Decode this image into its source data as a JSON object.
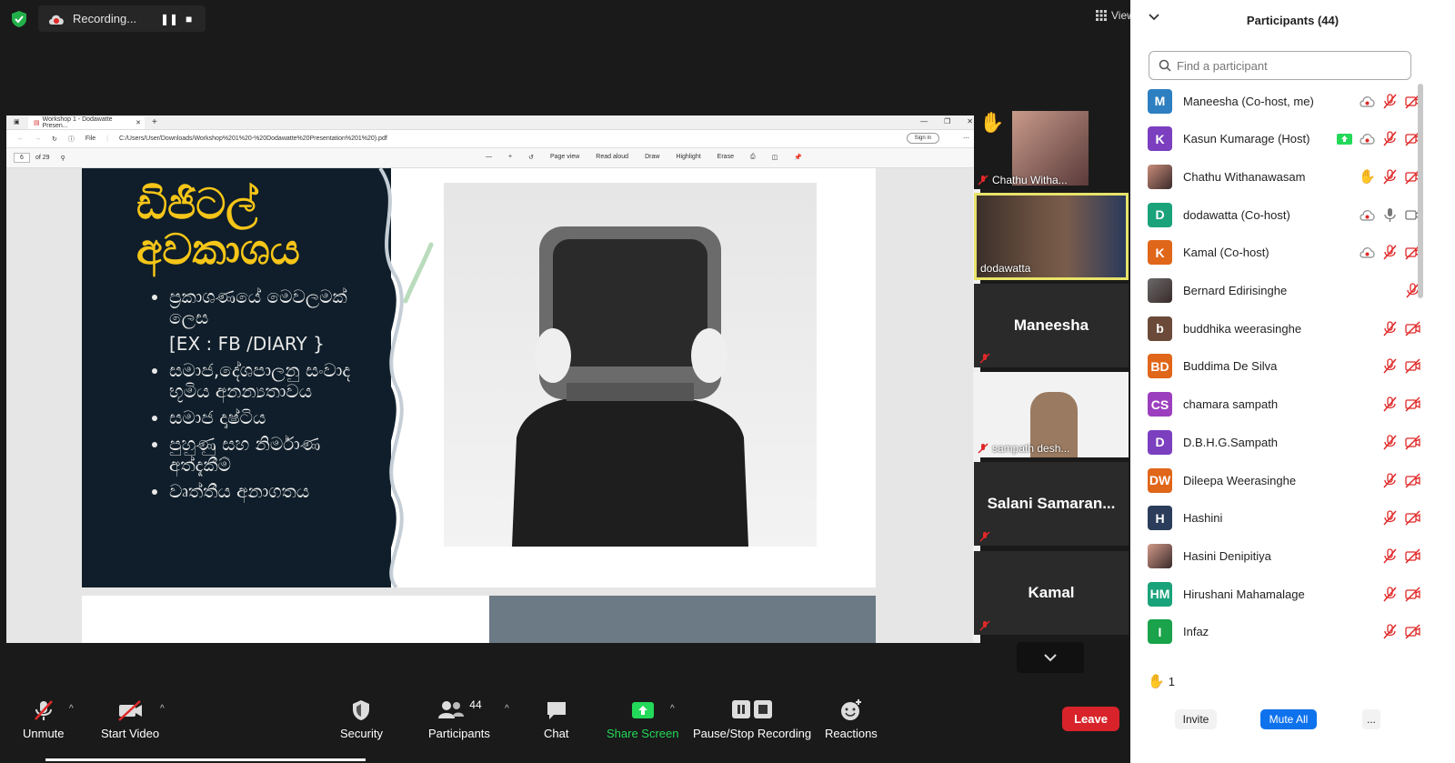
{
  "recording": {
    "label": "Recording..."
  },
  "view": {
    "label": "View"
  },
  "browser": {
    "tab_title": "Workshop 1 - Dodawatte Presen...",
    "file_label": "File",
    "url": "C:/Users/User/Downloads/Workshop%201%20-%20Dodawatte%20Presentation%201%20).pdf",
    "signin": "Sign in",
    "page_current": "6",
    "page_total": "of 29",
    "tools": {
      "page_view": "Page view",
      "read_aloud": "Read aloud",
      "draw": "Draw",
      "highlight": "Highlight",
      "erase": "Erase"
    }
  },
  "slide": {
    "title_line1": "ඩිජිටල්",
    "title_line2": "අවකාශය",
    "bullets": [
      "ප්‍රකාශණයේ මෙවලමක් ලෙස",
      "සමාජ,දේශපාලනු සංවාද භූමිය අනන්‍යතාවය",
      "සමාජ දෘෂ්ටිය",
      "පුහුණු සහ නිර්මාණ අත්දැකීම්",
      "වෘත්තීය අනාගතය"
    ],
    "sub_note": "[EX : FB /DIARY }"
  },
  "tiles": [
    {
      "name": "Chathu Witha...",
      "type": "video",
      "hand": true
    },
    {
      "name": "dodawatta",
      "type": "video",
      "active": true
    },
    {
      "name": "Maneesha",
      "type": "name"
    },
    {
      "name": "sampath desh...",
      "type": "video"
    },
    {
      "name": "Salani  Samaran...",
      "type": "name"
    },
    {
      "name": "Kamal",
      "type": "name"
    }
  ],
  "toolbar": {
    "unmute": "Unmute",
    "start_video": "Start Video",
    "security": "Security",
    "participants": "Participants",
    "participants_count": "44",
    "chat": "Chat",
    "share_screen": "Share Screen",
    "pause_stop": "Pause/Stop Recording",
    "reactions": "Reactions",
    "leave": "Leave"
  },
  "panel": {
    "title": "Participants (44)",
    "search_placeholder": "Find a participant",
    "raised_count": "1",
    "invite": "Invite",
    "mute_all": "Mute All",
    "more": "..."
  },
  "participants": [
    {
      "initials": "M",
      "name": "Maneesha (Co-host, me)",
      "color": "#2d7fc1",
      "icons": [
        "rec",
        "mic-off",
        "cam-off"
      ]
    },
    {
      "initials": "K",
      "name": "Kasun Kumarage (Host)",
      "color": "#7b3fbf",
      "icons": [
        "share",
        "rec",
        "mic-off",
        "cam-off"
      ]
    },
    {
      "initials": "",
      "name": "Chathu Withanawasam",
      "color": "#c98c7a",
      "photo": true,
      "icons": [
        "hand",
        "mic-off",
        "cam-off"
      ]
    },
    {
      "initials": "D",
      "name": "dodawatta (Co-host)",
      "color": "#1aa37a",
      "icons": [
        "rec",
        "mic-on",
        "cam-on"
      ]
    },
    {
      "initials": "K",
      "name": "Kamal (Co-host)",
      "color": "#e0661a",
      "icons": [
        "rec",
        "mic-off",
        "cam-off"
      ]
    },
    {
      "initials": "",
      "name": "Bernard Edirisinghe",
      "color": "#6a6a6a",
      "photo": true,
      "icons": [
        "mic-off"
      ]
    },
    {
      "initials": "b",
      "name": "buddhika weerasinghe",
      "color": "#6b4a3a",
      "icons": [
        "mic-off",
        "cam-off"
      ]
    },
    {
      "initials": "BD",
      "name": "Buddima De Silva",
      "color": "#e0661a",
      "icons": [
        "mic-off",
        "cam-off"
      ]
    },
    {
      "initials": "CS",
      "name": "chamara sampath",
      "color": "#9b3fbf",
      "icons": [
        "mic-off",
        "cam-off"
      ]
    },
    {
      "initials": "D",
      "name": "D.B.H.G.Sampath",
      "color": "#7b3fbf",
      "icons": [
        "mic-off",
        "cam-off"
      ]
    },
    {
      "initials": "DW",
      "name": "Dileepa Weerasinghe",
      "color": "#e0661a",
      "icons": [
        "mic-off",
        "cam-off"
      ]
    },
    {
      "initials": "H",
      "name": "Hashini",
      "color": "#2b3d5a",
      "icons": [
        "mic-off",
        "cam-off"
      ]
    },
    {
      "initials": "",
      "name": "Hasini Denipitiya",
      "color": "#d29a8a",
      "photo": true,
      "icons": [
        "mic-off",
        "cam-off"
      ]
    },
    {
      "initials": "HM",
      "name": "Hirushani Mahamalage",
      "color": "#1aa37a",
      "icons": [
        "mic-off",
        "cam-off"
      ]
    },
    {
      "initials": "I",
      "name": "Infaz",
      "color": "#1aa34a",
      "icons": [
        "mic-off",
        "cam-off"
      ]
    }
  ],
  "colors": {
    "accent": "#0e72ed",
    "leave": "#d8232a",
    "share": "#23d959",
    "muted": "#e02828",
    "slide_title": "#f5c518"
  }
}
